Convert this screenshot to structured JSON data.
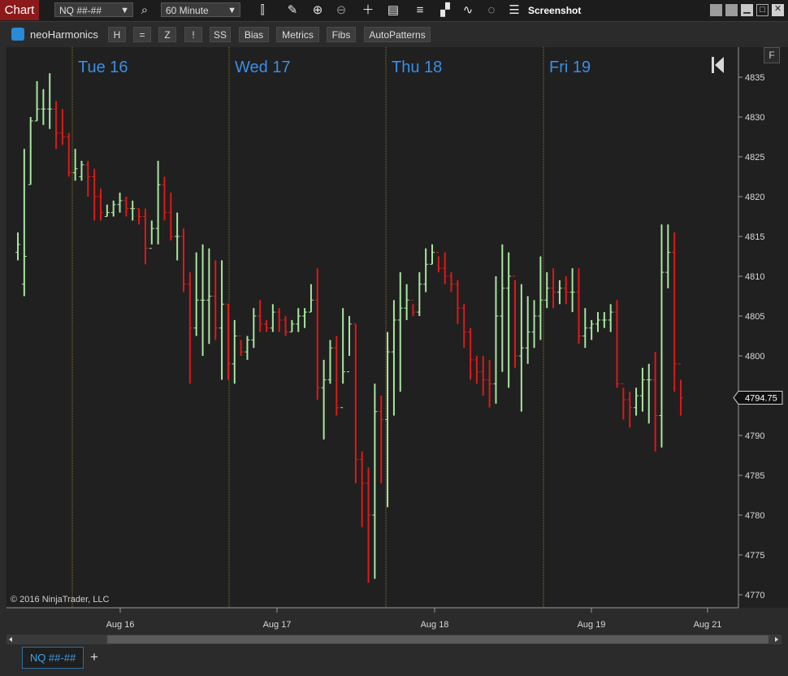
{
  "window": {
    "title": "Chart",
    "instrument": "NQ ##-##",
    "interval": "60 Minute",
    "screenshot_label": "Screenshot"
  },
  "toolbar_icons": [
    "search-icon",
    "bar-type-icon",
    "draw-pencil-icon",
    "zoom-in-icon",
    "zoom-out-icon",
    "crosshair-icon",
    "data-box-icon",
    "chart-style-icon",
    "indicators-icon",
    "strategies-icon",
    "refresh-icon",
    "properties-icon"
  ],
  "indicator_bar": {
    "name": "neoHarmonics",
    "buttons": [
      "H",
      "=",
      "Z",
      "!",
      "SS",
      "Bias",
      "Metrics",
      "Fibs",
      "AutoPatterns"
    ]
  },
  "f_button": "F",
  "copyright": "© 2016 NinjaTrader, LLC",
  "bottom_tab": "NQ ##-##",
  "add_tab": "+",
  "colors": {
    "up": "#a8e6a0",
    "down": "#e01818",
    "day_divider": "#8a7a20",
    "accent": "#3a8ee6",
    "price_label_bg": "#111111"
  },
  "chart_data": {
    "type": "ohlc",
    "day_labels": [
      "Tue 16",
      "Wed 17",
      "Thu 18",
      "Fri 19"
    ],
    "x_labels": [
      "Aug 16",
      "Aug 17",
      "Aug 18",
      "Aug 19",
      "Aug 21"
    ],
    "y_ticks": [
      4835,
      4830,
      4825,
      4820,
      4815,
      4810,
      4805,
      4800,
      4795,
      4790,
      4785,
      4780,
      4775,
      4770
    ],
    "ylim": [
      4768.5,
      4839
    ],
    "current_price": "4794.75",
    "grid": false,
    "series": [
      {
        "bars": [
          [
            4813,
            4815.5,
            4812,
            4814
          ],
          [
            4809,
            4826,
            4807.5,
            4812.5
          ],
          [
            4821.5,
            4830,
            4821.5,
            4829.5
          ],
          [
            4829.5,
            4834.5,
            4829.5,
            4831
          ],
          [
            4831,
            4833.5,
            4829,
            4831
          ],
          [
            4831,
            4835.5,
            4828.5,
            4831
          ],
          [
            4831,
            4832,
            4826,
            4828
          ],
          [
            4828,
            4831,
            4826.5,
            4827.5
          ],
          [
            4827.5,
            4828,
            4822.5,
            4823
          ],
          [
            4823,
            4826,
            4822,
            4823.5
          ],
          [
            4822.5,
            4824.5,
            4822,
            4824
          ],
          [
            4824,
            4824.5,
            4820,
            4822.5
          ],
          [
            4822.5,
            4823.5,
            4817,
            4820
          ],
          [
            4820,
            4821,
            4817,
            4818
          ],
          [
            4817.5,
            4819,
            4817.5,
            4818
          ],
          [
            4818,
            4819.5,
            4817.5,
            4819
          ],
          [
            4819,
            4820.5,
            4818,
            4819.5
          ],
          [
            4819.5,
            4820,
            4817.5,
            4818.5
          ],
          [
            4818.5,
            4819.5,
            4817,
            4818.5
          ],
          [
            4818.5,
            4818.5,
            4816.5,
            4817.5
          ],
          [
            4817.5,
            4818.5,
            4811.5,
            4813.5
          ],
          [
            4813.5,
            4817,
            4814,
            4816
          ],
          [
            4816,
            4824.5,
            4814,
            4821.5
          ],
          [
            4821.5,
            4822.5,
            4817,
            4818
          ],
          [
            4818,
            4820.5,
            4814.5,
            4815
          ],
          [
            4815,
            4818,
            4812,
            4815
          ],
          [
            4815,
            4816,
            4808,
            4809
          ],
          [
            4809,
            4810.5,
            4796.5,
            4803.5
          ],
          [
            4803.5,
            4813,
            4802.5,
            4807
          ],
          [
            4807,
            4814,
            4800,
            4807
          ],
          [
            4807,
            4813.5,
            4801.5,
            4807.5
          ],
          [
            4807.5,
            4812,
            4802,
            4803.5
          ],
          [
            4803.5,
            4812,
            4797,
            4806.5
          ],
          [
            4806.5,
            4806.5,
            4797,
            4799
          ],
          [
            4799,
            4804.5,
            4796.5,
            4802.5
          ],
          [
            4802.5,
            4802,
            4800,
            4800.5
          ],
          [
            4800.5,
            4802.5,
            4799.5,
            4802
          ],
          [
            4802,
            4806,
            4801,
            4805
          ],
          [
            4805,
            4807,
            4803,
            4804
          ],
          [
            4804,
            4804.5,
            4803,
            4803.5
          ],
          [
            4803.5,
            4806.5,
            4803,
            4805.5
          ],
          [
            4805.5,
            4806,
            4803,
            4804.5
          ],
          [
            4804.5,
            4805,
            4802.5,
            4803
          ],
          [
            4803,
            4804.5,
            4803,
            4804
          ],
          [
            4804,
            4806,
            4803,
            4805
          ],
          [
            4805,
            4806,
            4803.5,
            4805.5
          ],
          [
            4805.5,
            4809,
            4805.5,
            4807
          ],
          [
            4807,
            4811,
            4794.5,
            4796
          ],
          [
            4796,
            4799.5,
            4789.5,
            4797
          ],
          [
            4797,
            4802,
            4796.5,
            4801
          ],
          [
            4801,
            4802.5,
            4792.5,
            4793.5
          ],
          [
            4793.5,
            4806,
            4796.5,
            4798
          ],
          [
            4798,
            4805,
            4800,
            4804
          ],
          [
            4804,
            4804,
            4784,
            4787
          ],
          [
            4787,
            4788,
            4778.5,
            4784
          ],
          [
            4784,
            4786,
            4771.5,
            4780
          ],
          [
            4780,
            4796.5,
            4772,
            4793
          ],
          [
            4793,
            4795,
            4784,
            4792
          ],
          [
            4792,
            4803,
            4781,
            4800.5
          ],
          [
            4800.5,
            4807,
            4792.5,
            4804.5
          ],
          [
            4804.5,
            4810.5,
            4795.5,
            4806
          ],
          [
            4806,
            4809,
            4804.5,
            4807
          ],
          [
            4807,
            4806.5,
            4805,
            4805.5
          ],
          [
            4805.5,
            4810.5,
            4805,
            4809
          ],
          [
            4809,
            4813.5,
            4808,
            4811.5
          ],
          [
            4811.5,
            4814,
            4811.5,
            4813
          ],
          [
            4813,
            4812.5,
            4810.5,
            4811
          ],
          [
            4811,
            4813,
            4809,
            4810
          ],
          [
            4810,
            4810.5,
            4808,
            4809
          ],
          [
            4809,
            4809.5,
            4804,
            4806
          ],
          [
            4806,
            4806.5,
            4801,
            4803
          ],
          [
            4803,
            4803.5,
            4797,
            4799.5
          ],
          [
            4799.5,
            4800,
            4796.5,
            4798
          ],
          [
            4798,
            4800,
            4795,
            4797
          ],
          [
            4797,
            4799.5,
            4793.5,
            4796.5
          ],
          [
            4796.5,
            4810,
            4794,
            4805
          ],
          [
            4805,
            4814,
            4798,
            4808.5
          ],
          [
            4808.5,
            4813,
            4796,
            4810
          ],
          [
            4810,
            4809.5,
            4798.5,
            4800
          ],
          [
            4800,
            4809,
            4793,
            4801
          ],
          [
            4801,
            4807.5,
            4799,
            4803
          ],
          [
            4803,
            4807,
            4801,
            4805
          ],
          [
            4805,
            4812.5,
            4802,
            4807
          ],
          [
            4807,
            4810.5,
            4806,
            4808.5
          ],
          [
            4808.5,
            4811,
            4806,
            4808
          ],
          [
            4808,
            4809.5,
            4806.5,
            4808.5
          ],
          [
            4808.5,
            4810,
            4806.5,
            4808
          ],
          [
            4808,
            4811,
            4805.5,
            4808
          ],
          [
            4808,
            4811,
            4801.5,
            4802.5
          ],
          [
            4802.5,
            4806,
            4801,
            4803.5
          ],
          [
            4803.5,
            4804.5,
            4802,
            4804
          ],
          [
            4804,
            4805.5,
            4803,
            4804.5
          ],
          [
            4804.5,
            4805.5,
            4803.5,
            4804.5
          ],
          [
            4804.5,
            4806.5,
            4803,
            4805.5
          ],
          [
            4805.5,
            4807,
            4796,
            4796.5
          ],
          [
            4796.5,
            4796,
            4792,
            4794.5
          ],
          [
            4794.5,
            4795.5,
            4791,
            4793.5
          ],
          [
            4793.5,
            4796,
            4792.5,
            4795
          ],
          [
            4795,
            4798.5,
            4793,
            4797
          ],
          [
            4797,
            4799,
            4791.5,
            4797
          ],
          [
            4797,
            4800.5,
            4788,
            4792.5
          ],
          [
            4792.5,
            4816.5,
            4788.5,
            4810.5
          ],
          [
            4810.5,
            4816.5,
            4808.5,
            4813
          ],
          [
            4813,
            4815.5,
            4795.5,
            4799
          ],
          [
            4799,
            4797,
            4792.5,
            4794.75
          ]
        ]
      }
    ]
  }
}
